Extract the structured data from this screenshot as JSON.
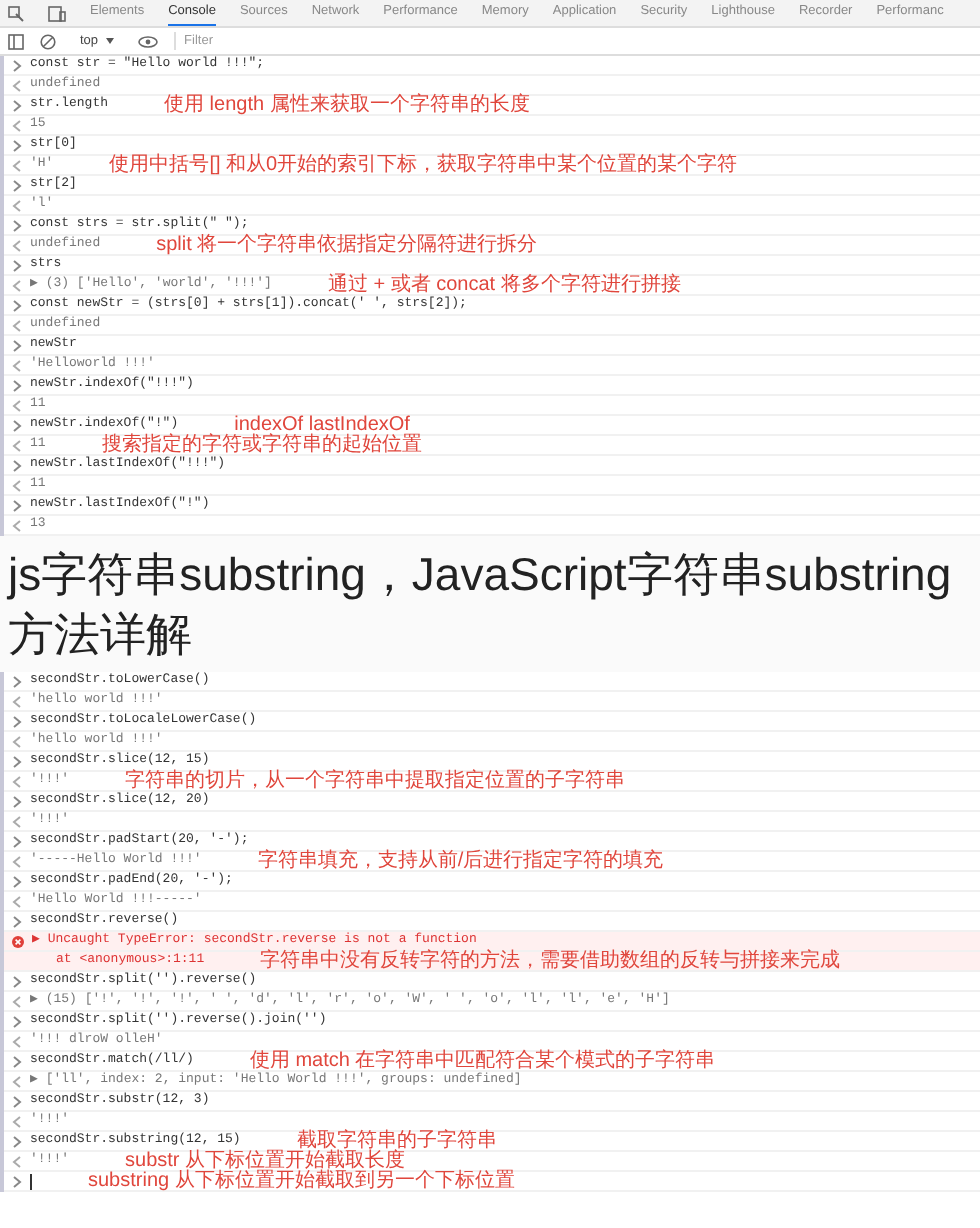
{
  "tabs": [
    {
      "label": "Elements",
      "selected": false
    },
    {
      "label": "Console",
      "selected": true
    },
    {
      "label": "Sources",
      "selected": false
    },
    {
      "label": "Network",
      "selected": false
    },
    {
      "label": "Performance",
      "selected": false
    },
    {
      "label": "Memory",
      "selected": false
    },
    {
      "label": "Application",
      "selected": false
    },
    {
      "label": "Security",
      "selected": false
    },
    {
      "label": "Lighthouse",
      "selected": false
    },
    {
      "label": "Recorder",
      "selected": false
    },
    {
      "label": "Performanc",
      "selected": false
    }
  ],
  "toolbar": {
    "context": "top",
    "filter": {
      "placeholder": "Filter"
    }
  },
  "lines_top": [
    {
      "kind": "input",
      "text": "const str = \"Hello world !!!\";"
    },
    {
      "kind": "output",
      "text": "undefined"
    },
    {
      "kind": "input",
      "text": "str.length",
      "note": "使用 length 属性来获取一个字符串的长度"
    },
    {
      "kind": "output",
      "text": "15"
    },
    {
      "kind": "input",
      "text": "str[0]"
    },
    {
      "kind": "output",
      "text": "'H'",
      "note": "使用中括号[] 和从0开始的索引下标，获取字符串中某个位置的某个字符"
    },
    {
      "kind": "input",
      "text": "str[2]"
    },
    {
      "kind": "output",
      "text": "'l'"
    },
    {
      "kind": "input",
      "text": "const strs = str.split(\" \");"
    },
    {
      "kind": "output",
      "text": "undefined",
      "note": "split 将一个字符串依据指定分隔符进行拆分"
    },
    {
      "kind": "input",
      "text": "strs"
    },
    {
      "kind": "output",
      "text": "▶ (3) ['Hello', 'world', '!!!']",
      "note": "通过 + 或者 concat 将多个字符进行拼接"
    },
    {
      "kind": "input",
      "text": "const newStr = (strs[0] + strs[1]).concat(' ', strs[2]);"
    },
    {
      "kind": "output",
      "text": "undefined"
    },
    {
      "kind": "input",
      "text": "newStr"
    },
    {
      "kind": "output",
      "text": "'Helloworld !!!'"
    },
    {
      "kind": "input",
      "text": "newStr.indexOf(\"!!!\")"
    },
    {
      "kind": "output",
      "text": "11"
    },
    {
      "kind": "input",
      "text": "newStr.indexOf(\"!\")",
      "note": "indexOf lastIndexOf"
    },
    {
      "kind": "output",
      "text": "11",
      "note": "搜索指定的字符或字符串的起始位置"
    },
    {
      "kind": "input",
      "text": "newStr.lastIndexOf(\"!!!\")"
    },
    {
      "kind": "output",
      "text": "11"
    },
    {
      "kind": "input",
      "text": "newStr.lastIndexOf(\"!\")"
    },
    {
      "kind": "output",
      "text": "13"
    }
  ],
  "title": "js字符串substring，JavaScript字符串substring方法详解",
  "lines_bottom": [
    {
      "kind": "input",
      "text": "secondStr.toLowerCase()"
    },
    {
      "kind": "output",
      "text": "'hello world !!!'"
    },
    {
      "kind": "input",
      "text": "secondStr.toLocaleLowerCase()"
    },
    {
      "kind": "output",
      "text": "'hello world !!!'"
    },
    {
      "kind": "input",
      "text": "secondStr.slice(12, 15)"
    },
    {
      "kind": "output",
      "text": "'!!!'",
      "note": "字符串的切片，从一个字符串中提取指定位置的子字符串"
    },
    {
      "kind": "input",
      "text": "secondStr.slice(12, 20)"
    },
    {
      "kind": "output",
      "text": "'!!!'"
    },
    {
      "kind": "input",
      "text": "secondStr.padStart(20, '-');"
    },
    {
      "kind": "output",
      "text": "'-----Hello World !!!'",
      "note": "字符串填充，支持从前/后进行指定字符的填充"
    },
    {
      "kind": "input",
      "text": "secondStr.padEnd(20, '-');"
    },
    {
      "kind": "output",
      "text": "'Hello World !!!-----'"
    },
    {
      "kind": "input",
      "text": "secondStr.reverse()"
    },
    {
      "kind": "error",
      "text": "▶ Uncaught TypeError: secondStr.reverse is not a function"
    },
    {
      "kind": "error_detail",
      "text": "at <anonymous>:1:11",
      "note": "字符串中没有反转字符的方法，需要借助数组的反转与拼接来完成"
    },
    {
      "kind": "input",
      "text": "secondStr.split('').reverse()"
    },
    {
      "kind": "output",
      "text": "▶ (15) ['!', '!', '!', ' ', 'd', 'l', 'r', 'o', 'W', ' ', 'o', 'l', 'l', 'e', 'H']"
    },
    {
      "kind": "input",
      "text": "secondStr.split('').reverse().join('')"
    },
    {
      "kind": "output",
      "text": "'!!! dlroW olleH'"
    },
    {
      "kind": "input",
      "text": "secondStr.match(/ll/)",
      "note": "使用 match 在字符串中匹配符合某个模式的子字符串"
    },
    {
      "kind": "output",
      "text": "▶ ['ll', index: 2, input: 'Hello World !!!', groups: undefined]"
    },
    {
      "kind": "input",
      "text": "secondStr.substr(12, 3)"
    },
    {
      "kind": "output",
      "text": "'!!!'"
    },
    {
      "kind": "input",
      "text": "secondStr.substring(12, 15)",
      "note": "截取字符串的子字符串"
    },
    {
      "kind": "output",
      "text": "'!!!'",
      "note": "substr 从下标位置开始截取长度"
    },
    {
      "kind": "cursor",
      "note": "substring 从下标位置开始截取到另一个下标位置"
    }
  ]
}
